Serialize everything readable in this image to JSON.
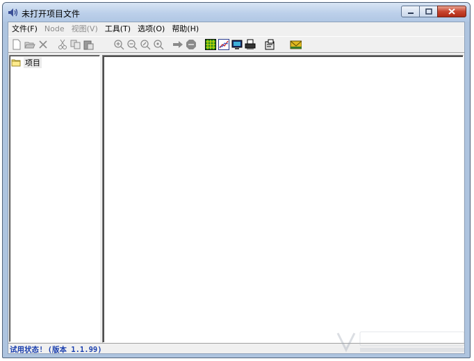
{
  "window": {
    "title": "未打开项目文件",
    "buttons": [
      "minimize",
      "maximize",
      "close"
    ]
  },
  "menu": [
    {
      "label": "文件(F)",
      "enabled": true
    },
    {
      "label": "Node",
      "enabled": false
    },
    {
      "label": "视图(V)",
      "enabled": false
    },
    {
      "label": "工具(T)",
      "enabled": true
    },
    {
      "label": "选项(O)",
      "enabled": true
    },
    {
      "label": "帮助(H)",
      "enabled": true
    }
  ],
  "toolbar": {
    "icons": [
      "new-file-icon",
      "open-folder-icon",
      "delete-icon",
      "cut-icon",
      "copy-icon",
      "paste-icon",
      "zoom-in-icon",
      "zoom-out-icon",
      "zoom-fit-icon",
      "zoom-reset-icon",
      "run-arrow-icon",
      "stop-icon",
      "grid-view-icon",
      "chart-icon",
      "monitor-icon",
      "print-icon",
      "properties-icon",
      "mail-icon"
    ]
  },
  "tree": {
    "root_label": "项目"
  },
  "status": {
    "text": "试用状态! (版本 1.1.99)"
  },
  "colors": {
    "status_text": "#1a3fae",
    "title_bar": "#bcd0ea",
    "close_button": "#c7452f"
  }
}
